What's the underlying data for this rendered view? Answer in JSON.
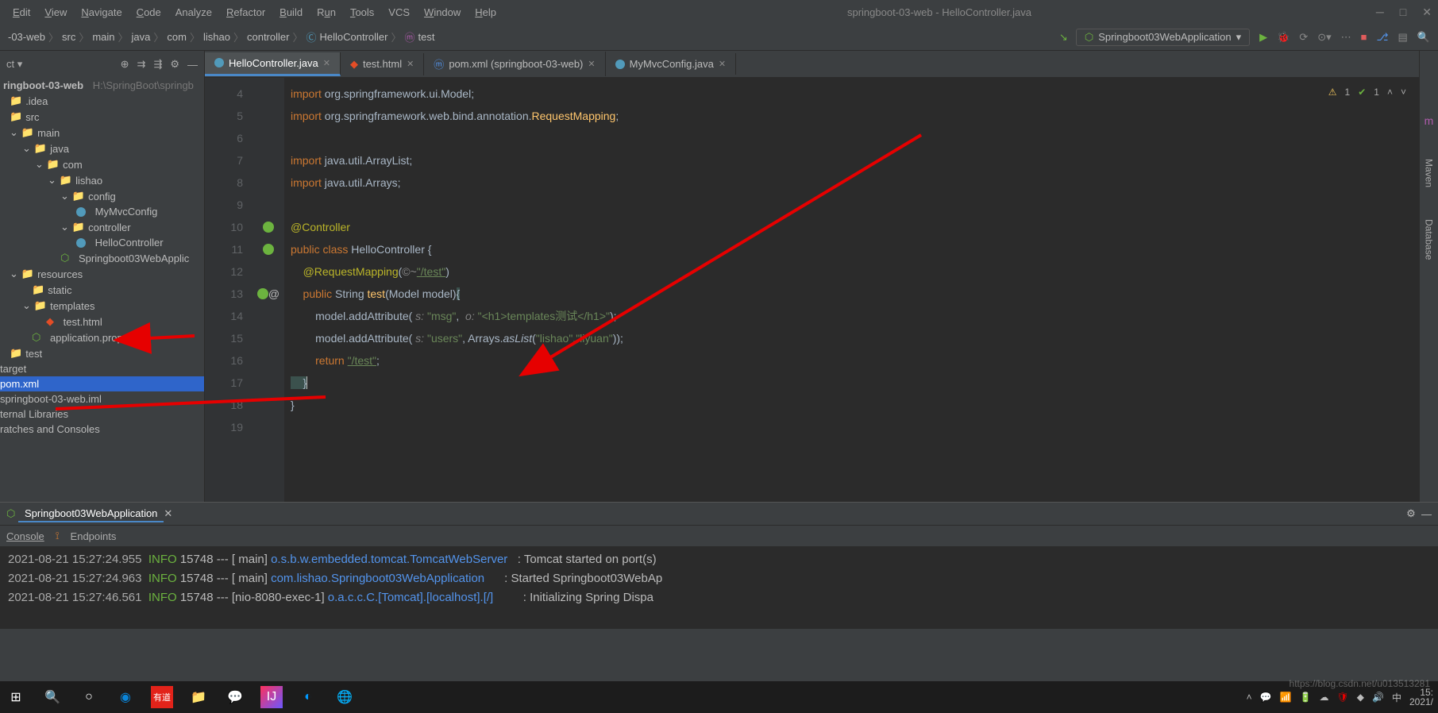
{
  "menubar": [
    "Edit",
    "View",
    "Navigate",
    "Code",
    "Analyze",
    "Refactor",
    "Build",
    "Run",
    "Tools",
    "VCS",
    "Window",
    "Help"
  ],
  "window_title": "springboot-03-web - HelloController.java",
  "breadcrumbs": [
    "-03-web",
    "src",
    "main",
    "java",
    "com",
    "lishao",
    "controller",
    "HelloController",
    "test"
  ],
  "run_config": "Springboot03WebApplication",
  "project_tree": {
    "root_label": "ringboot-03-web",
    "root_path": "H:\\SpringBoot\\springb",
    "items": [
      ".idea",
      "src",
      "main",
      "java",
      "com",
      "lishao",
      "config",
      "MyMvcConfig",
      "controller",
      "HelloController",
      "Springboot03WebApplic",
      "resources",
      "static",
      "templates",
      "test.html",
      "application.properties",
      "test",
      "target",
      "pom.xml",
      "springboot-03-web.iml",
      "ternal Libraries",
      "ratches and Consoles"
    ]
  },
  "tabs": [
    {
      "label": "HelloController.java",
      "active": true,
      "icon": "java"
    },
    {
      "label": "test.html",
      "active": false,
      "icon": "html"
    },
    {
      "label": "pom.xml (springboot-03-web)",
      "active": false,
      "icon": "maven"
    },
    {
      "label": "MyMvcConfig.java",
      "active": false,
      "icon": "java"
    }
  ],
  "line_numbers": [
    4,
    5,
    6,
    7,
    8,
    9,
    10,
    11,
    12,
    13,
    14,
    15,
    16,
    17,
    18,
    19
  ],
  "code": {
    "l4": {
      "kw": "import",
      "pkg": " org.springframework.ui.Model;"
    },
    "l5": {
      "kw": "import",
      "pkg": " org.springframework.web.bind.annotation.",
      "cls": "RequestMapping",
      ";": ";"
    },
    "l7": {
      "kw": "import",
      "pkg": " java.util.ArrayList;"
    },
    "l8": {
      "kw": "import",
      "pkg": " java.util.Arrays;"
    },
    "l10": "@Controller",
    "l11": {
      "pub": "public ",
      "cls": "class ",
      "name": "HelloController ",
      "brace": "{"
    },
    "l12": {
      "ann": "@RequestMapping",
      "open": "(",
      "icon": "©~",
      "path": "\"/test\"",
      "close": ")"
    },
    "l13": {
      "pub": "    public ",
      "ret": "String ",
      "fn": "test",
      "args": "(Model model)",
      "brace": "{"
    },
    "l14": {
      "obj": "        model.addAttribute(",
      "p1": " s: ",
      "v1": "\"msg\"",
      "c": ", ",
      "p2": " o: ",
      "v2": "\"<h1>templates测试</h1>\"",
      "end": ");"
    },
    "l15": {
      "obj": "        model.addAttribute(",
      "p1": " s: ",
      "v1": "\"users\"",
      "c": ", Arrays.",
      "m": "asList",
      "args": "(",
      "s1": "\"lishao\"",
      "cm": ",",
      "s2": "\"liyuan\"",
      "end": "));"
    },
    "l16": {
      "ret": "        return ",
      "v": "\"/test\"",
      "end": ";"
    },
    "l17": "    }",
    "l18": "}"
  },
  "inspections": {
    "warnings": "1",
    "checks": "1"
  },
  "right_tool_tabs": [
    "Maven",
    "Database"
  ],
  "run_tool": {
    "tab": "Springboot03WebApplication",
    "subtabs": [
      "Console",
      "Endpoints"
    ]
  },
  "console_lines": [
    {
      "ts": "2021-08-21 15:27:24.955",
      "lvl": "INFO",
      "pid": "15748",
      "thread": "[              main]",
      "logger": "o.s.b.w.embedded.tomcat.TomcatWebServer",
      "msg": ": Tomcat started on port(s)"
    },
    {
      "ts": "2021-08-21 15:27:24.963",
      "lvl": "INFO",
      "pid": "15748",
      "thread": "[              main]",
      "logger": "com.lishao.Springboot03WebApplication",
      "msg": ": Started Springboot03WebAp"
    },
    {
      "ts": "2021-08-21 15:27:46.561",
      "lvl": "INFO",
      "pid": "15748",
      "thread": "[nio-8080-exec-1]",
      "logger": "o.a.c.c.C.[Tomcat].[localhost].[/]",
      "msg": ": Initializing Spring Dispa"
    }
  ],
  "clock": {
    "time": "15:",
    "date": "2021/"
  },
  "watermark": "https://blog.csdn.net/u013513281"
}
